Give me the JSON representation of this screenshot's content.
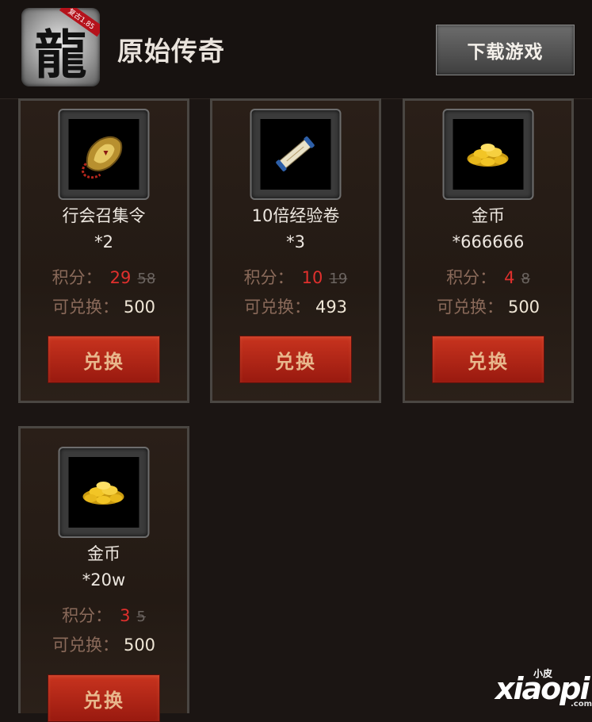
{
  "header": {
    "logo_text": "龍",
    "logo_badge": "复古1.85",
    "title": "原始传奇",
    "download_label": "下载游戏"
  },
  "labels": {
    "points": "积分：",
    "redeemable": "可兑换：",
    "redeem_button": "兑换"
  },
  "items": [
    {
      "name": "行会召集令",
      "qty": "*2",
      "price": "29",
      "old_price": "58",
      "remaining": "500",
      "icon": "guild-token-icon"
    },
    {
      "name": "10倍经验卷",
      "qty": "*3",
      "price": "10",
      "old_price": "19",
      "remaining": "493",
      "icon": "scroll-icon"
    },
    {
      "name": "金币",
      "qty": "*666666",
      "price": "4",
      "old_price": "8",
      "remaining": "500",
      "icon": "gold-coins-icon"
    },
    {
      "name": "金币",
      "qty": "*20w",
      "price": "3",
      "old_price": "5",
      "remaining": "500",
      "icon": "gold-coins-icon"
    }
  ],
  "watermark": {
    "main": "xiaopi",
    "small": "小皮",
    "suffix": ".com"
  },
  "colors": {
    "background": "#1b1513",
    "price_red": "#e0302d",
    "button_red": "#b52a18",
    "label_brown": "#8a6a5a"
  }
}
